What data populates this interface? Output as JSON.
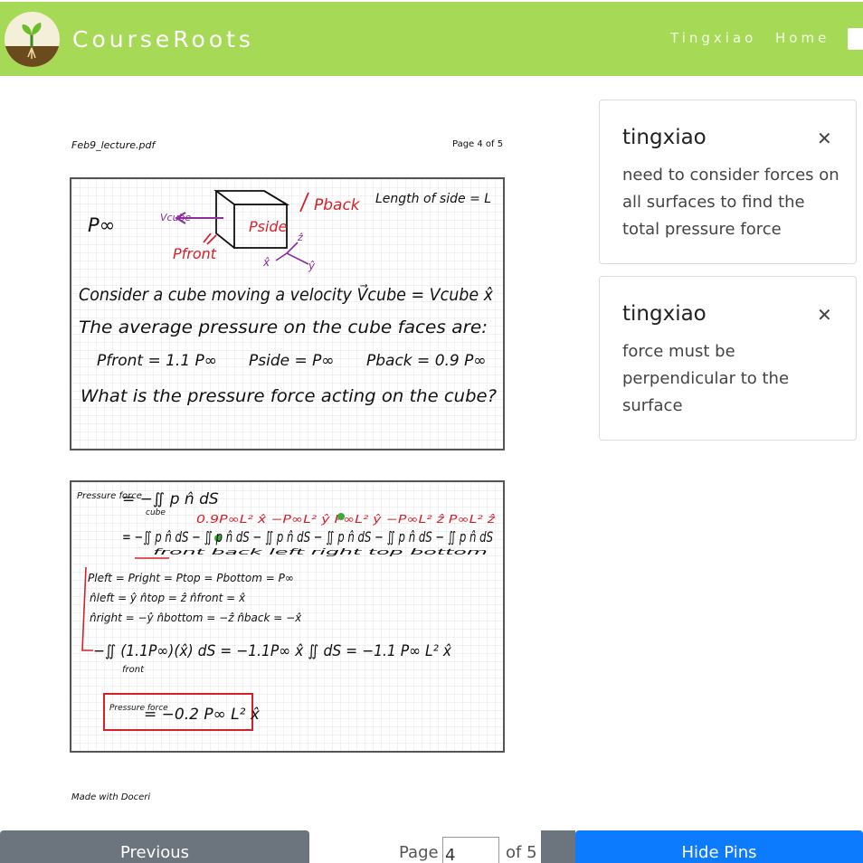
{
  "header": {
    "brand": "CourseRoots",
    "user_label": "Tingxiao",
    "home_label": "Home",
    "background_color": "#a6da56"
  },
  "document": {
    "filename": "Feb9_lecture.pdf",
    "page_label": "Page 4 of 5",
    "footer": "Made with Doceri",
    "slide1": {
      "p_inf": "P∞",
      "v_cube_label": "Vcube",
      "p_front_label": "Pfront",
      "p_side_label": "Pside",
      "p_back_label": "Pback",
      "length_label": "Length of side = L",
      "axis_x": "x̂",
      "axis_y": "ŷ",
      "axis_z": "ẑ",
      "line1": "Consider a cube moving a velocity V⃗cube = Vcube x̂",
      "line2": "The average pressure on the cube faces are:",
      "line3_a": "Pfront = 1.1 P∞",
      "line3_b": "Pside = P∞",
      "line3_c": "Pback = 0.9 P∞",
      "line4": "What is the pressure force acting on the cube?"
    },
    "slide2": {
      "pressure_force": "Pressure force",
      "eq1": "= −∬ p n̂ dS",
      "eq1_sub": "cube",
      "red_terms": "0.9P∞L² x̂   −P∞L² ŷ   P∞L² ŷ   −P∞L² ẑ   P∞L² ẑ",
      "eq2": "= −∬ p n̂ dS − ∬ p n̂ dS − ∬ p n̂ dS − ∬ p n̂ dS − ∬ p n̂ dS − ∬ p n̂ dS",
      "eq2_subs": "front        back        left        right        top        bottom",
      "line_p": "Pleft = Pright = Ptop = Pbottom = P∞",
      "line_n1": "n̂left = ŷ     n̂top = ẑ     n̂front = x̂",
      "line_n2": "n̂right = −ŷ     n̂bottom = −ẑ     n̂back = −x̂",
      "eq3": "−∬ (1.1P∞)(x̂) dS = −1.1P∞ x̂ ∬ dS = −1.1 P∞ L² x̂",
      "eq3_sub": "front",
      "result_label": "Pressure force",
      "result_value": "= −0.2 P∞ L² x̂"
    }
  },
  "pins": [
    {
      "author": "tingxiao",
      "text": "need to consider forces on all surfaces to find the total pressure force"
    },
    {
      "author": "tingxiao",
      "text": "force must be perpendicular to the surface"
    }
  ],
  "controls": {
    "previous_label": "Previous",
    "page_word": "Page",
    "page_value": "4",
    "of_label": "of 5",
    "hide_pins_label": "Hide Pins"
  },
  "icons": {
    "logo": "sprout-logo-icon",
    "close": "close-icon",
    "nav": "document-icon"
  },
  "colors": {
    "brand_green": "#a6da56",
    "primary_blue": "#0d7bfd",
    "secondary_gray": "#6c757d",
    "ink_red": "#d8202a",
    "ink_purple": "#8e2ca0"
  }
}
